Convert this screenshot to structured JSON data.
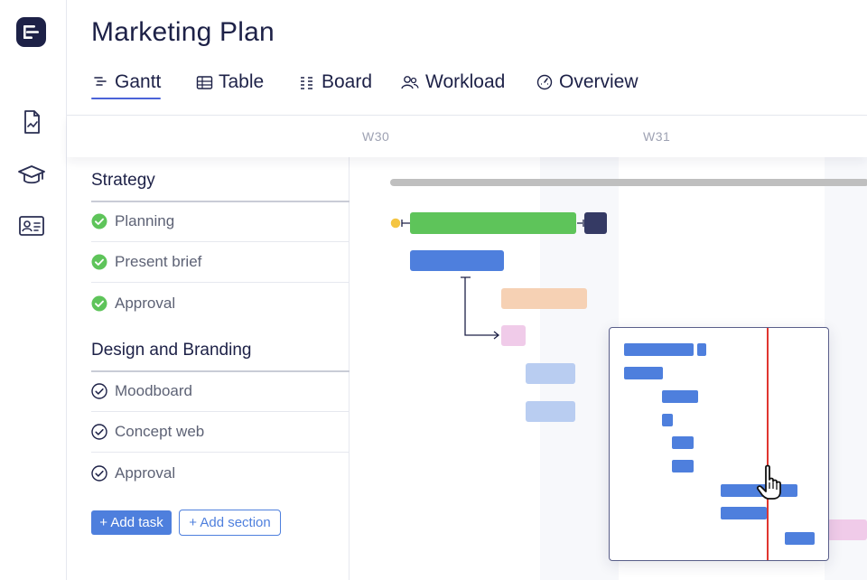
{
  "page": {
    "title": "Marketing Plan"
  },
  "sidebar": {
    "logo_icon": "app-logo-icon",
    "items": [
      {
        "icon": "report-document-icon"
      },
      {
        "icon": "graduation-cap-icon"
      },
      {
        "icon": "contact-card-icon"
      }
    ]
  },
  "tabs": [
    {
      "label": "Gantt",
      "icon": "gantt-icon",
      "active": true
    },
    {
      "label": "Table",
      "icon": "table-icon",
      "active": false
    },
    {
      "label": "Board",
      "icon": "board-icon",
      "active": false
    },
    {
      "label": "Workload",
      "icon": "people-icon",
      "active": false
    },
    {
      "label": "Overview",
      "icon": "dashboard-icon",
      "active": false
    }
  ],
  "timeline": {
    "weeks": [
      "W30",
      "W31"
    ]
  },
  "sections": [
    {
      "title": "Strategy",
      "tasks": [
        {
          "label": "Planning",
          "status": "done"
        },
        {
          "label": "Present brief",
          "status": "done"
        },
        {
          "label": "Approval",
          "status": "done"
        }
      ]
    },
    {
      "title": "Design and Branding",
      "tasks": [
        {
          "label": "Moodboard",
          "status": "open"
        },
        {
          "label": "Concept web",
          "status": "open"
        },
        {
          "label": "Approval",
          "status": "open"
        }
      ]
    }
  ],
  "actions": {
    "add_task": "+ Add task",
    "add_section": "+ Add section"
  },
  "colors": {
    "brand": "#1d2147",
    "accent_blue": "#4e7fdd",
    "done_green": "#5ec45a",
    "summary_gray": "#bfbfbf",
    "milestone_yellow": "#f4c542",
    "peach": "#f6d1b4",
    "pink": "#f0cbe9",
    "light_blue": "#b9cdf1",
    "today_red": "#e0362f"
  }
}
